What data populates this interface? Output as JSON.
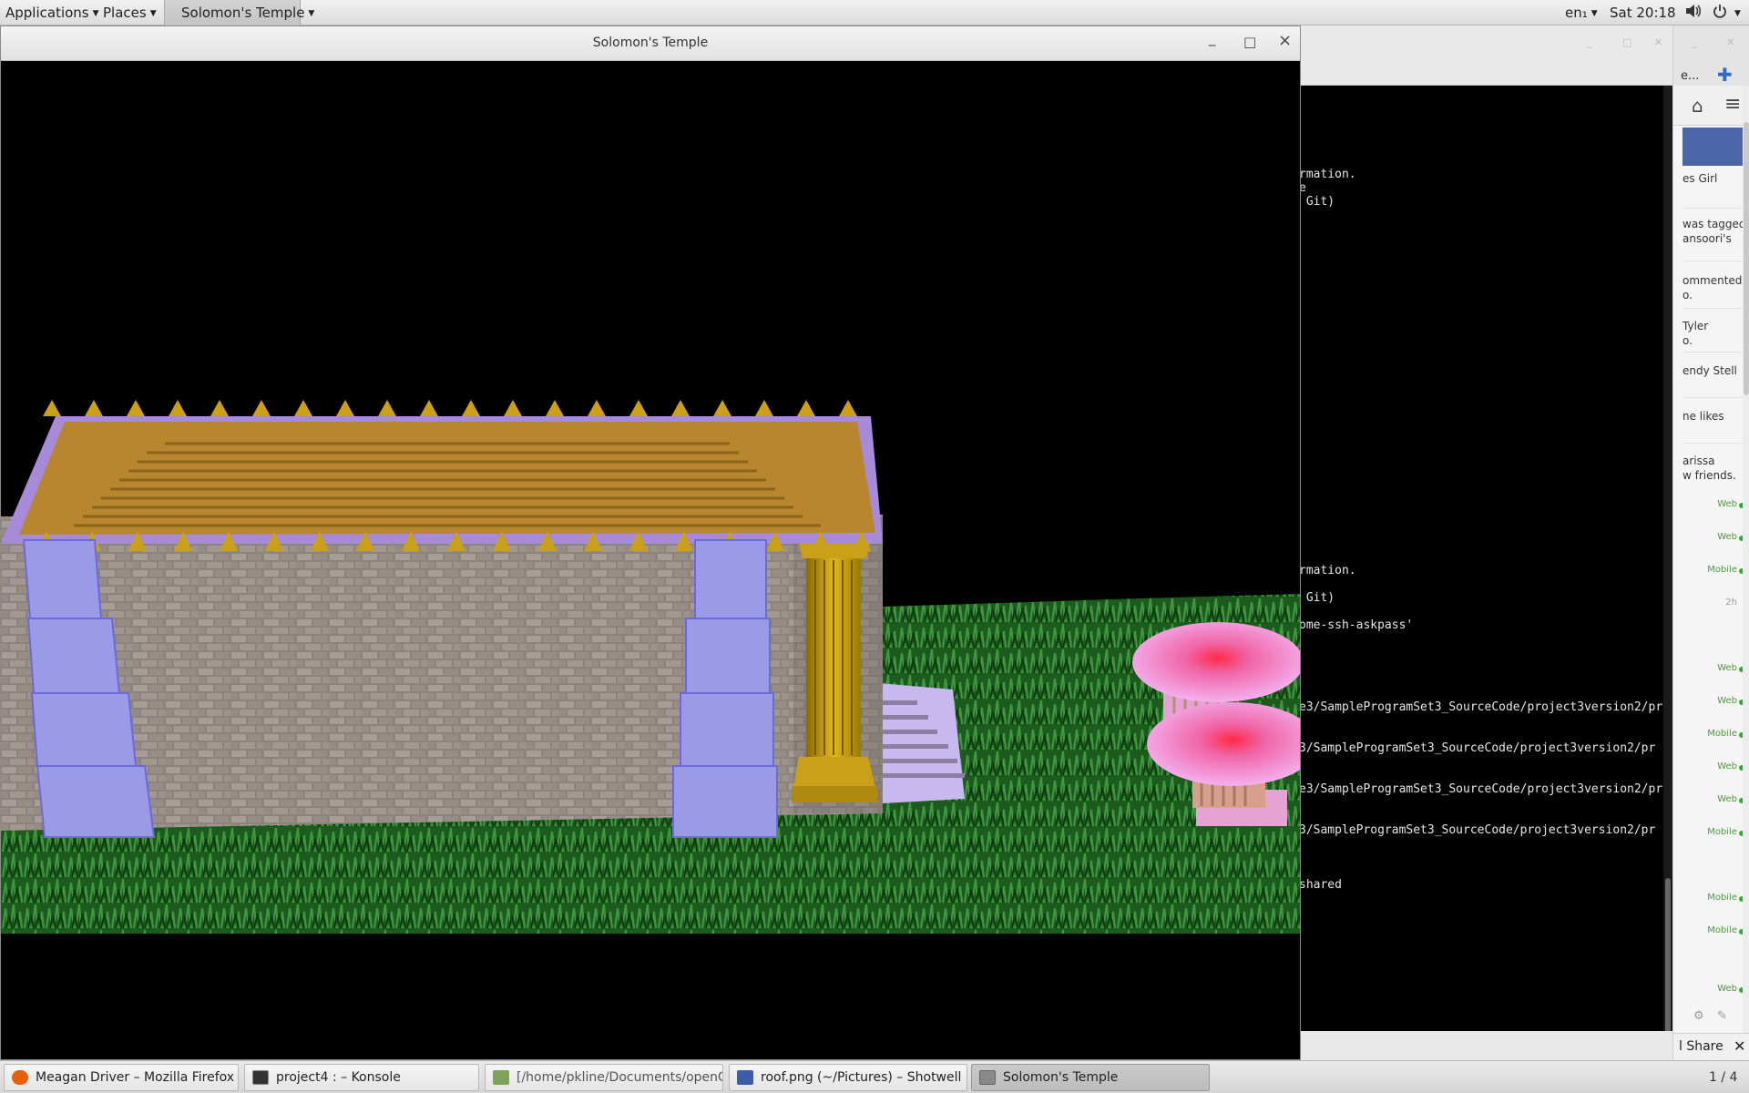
{
  "top_panel": {
    "applications_label": "Applications",
    "places_label": "Places",
    "window_menu_label": "Solomon's Temple",
    "input_method": "en₁",
    "clock": "Sat 20:18"
  },
  "gl_window": {
    "title": "Solomon's Temple",
    "minimize_glyph": "_",
    "maximize_glyph": "□",
    "close_glyph": "×"
  },
  "terminal": {
    "lines": [
      "rmation.",
      "e",
      " Git)",
      "rmation.",
      " Git)",
      "ome-ssh-askpass'",
      "e3/SampleProgramSet3_SourceCode/project3version2/pr",
      "3/SampleProgramSet3_SourceCode/project3version2/pr",
      "e3/SampleProgramSet3_SourceCode/project3version2/pr",
      "3/SampleProgramSet3_SourceCode/project3version2/pr",
      "shared"
    ]
  },
  "firefox_sidebar": {
    "tab_text": "e...",
    "notifications": [
      "es Girl",
      "was tagged\nansoori's",
      "ommented\no.",
      "Tyler\no.",
      "endy Stell",
      "ne likes",
      "arissa\nw friends."
    ],
    "chat_statuses": [
      "Web",
      "Web",
      "Mobile",
      "2h",
      "Web",
      "Web",
      "Mobile",
      "Web",
      "Web",
      "Mobile",
      "Mobile",
      "Mobile",
      "Web"
    ],
    "share_label": "l Share"
  },
  "taskbar": {
    "tasks": [
      {
        "label": "Meagan Driver – Mozilla Firefox",
        "icon": "firefox-icon",
        "color": "#e66000"
      },
      {
        "label": "project4 : – Konsole",
        "icon": "konsole-icon",
        "color": "#333333"
      },
      {
        "label": "[/home/pkline/Documents/openGL...",
        "icon": "gedit-icon",
        "color": "#7fa35a"
      },
      {
        "label": "roof.png (~/Pictures) – Shotwell",
        "icon": "shotwell-icon",
        "color": "#3b5ea8"
      },
      {
        "label": "Solomon's Temple",
        "icon": "window-icon",
        "color": "#888888"
      }
    ],
    "workspace": "1 / 4"
  },
  "colors": {
    "grass": "#1f5a1f",
    "stone": "#8a7f79",
    "roof": "#b8862e",
    "gold_column": "#c9a017",
    "lavender_pillar": "#9a9ae6",
    "fountain_pink": "#f08ad6"
  }
}
